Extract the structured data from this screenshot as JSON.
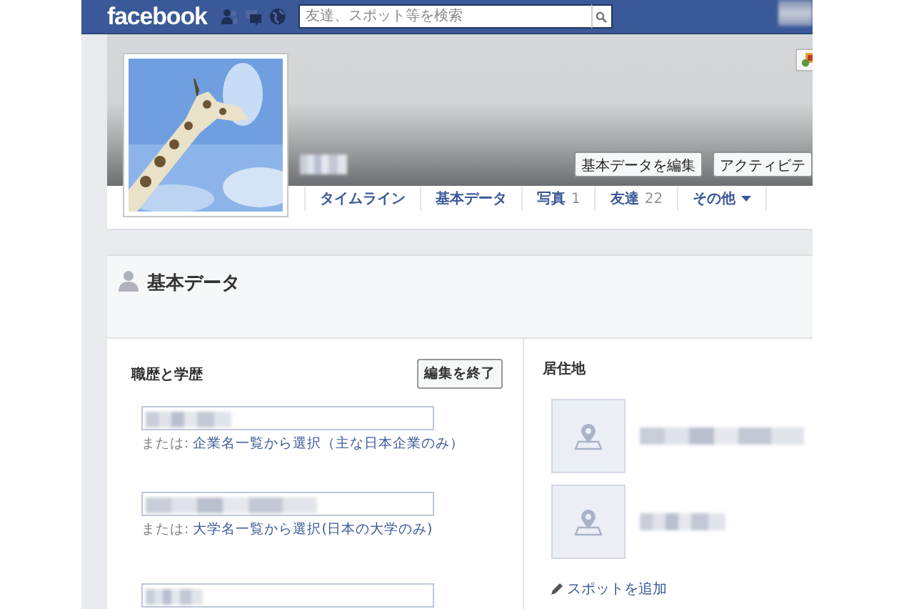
{
  "header": {
    "logo": "facebook",
    "search": {
      "placeholder": "友達、スポット等を検索"
    }
  },
  "profile": {
    "buttons": [
      "基本データを編集",
      "アクティビテ"
    ]
  },
  "nav": {
    "tabs": [
      {
        "label": "タイムライン",
        "kind": "plain"
      },
      {
        "label": "基本データ",
        "kind": "plain"
      },
      {
        "label": "写真",
        "count": "1",
        "kind": "count"
      },
      {
        "label": "友達",
        "count": "22",
        "kind": "count"
      },
      {
        "label": "その他",
        "kind": "menu"
      }
    ]
  },
  "about": {
    "title": "基本データ",
    "work_education": {
      "title": "職歴と学歴",
      "done_button": "編集を終了",
      "fields": [
        {
          "kind": "with_hint",
          "hint_prefix": "または:",
          "link": "企業名一覧から選択（主な日本企業のみ）"
        },
        {
          "kind": "with_hint",
          "hint_prefix": "または:",
          "link": "大学名一覧から選択(日本の大学のみ)"
        },
        {
          "kind": "plain"
        }
      ]
    },
    "residence": {
      "title": "居住地",
      "places": [
        {
          "kind": "place"
        },
        {
          "kind": "place"
        }
      ],
      "add_link": "スポットを追加"
    }
  }
}
